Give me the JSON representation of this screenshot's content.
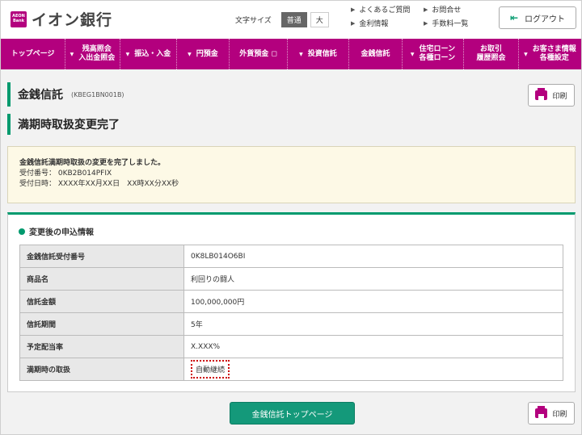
{
  "header": {
    "logo_mark": "AEON Bank",
    "logo_text": "イオン銀行",
    "fontsize_label": "文字サイズ",
    "fontsize_options": [
      "普通",
      "大"
    ],
    "links": [
      "よくあるご質問",
      "お問合せ",
      "金利情報",
      "手数料一覧"
    ],
    "logout_label": "ログアウト"
  },
  "nav": {
    "items": [
      {
        "label": "トップページ",
        "caret": false
      },
      {
        "label": "残高照会\n入出金照会",
        "caret": true
      },
      {
        "label": "振込・入金",
        "caret": true
      },
      {
        "label": "円預金",
        "caret": true
      },
      {
        "label": "外貨預金 ◻",
        "caret": false
      },
      {
        "label": "投資信託",
        "caret": true
      },
      {
        "label": "金銭信託",
        "caret": false
      },
      {
        "label": "住宅ローン\n各種ローン",
        "caret": true
      },
      {
        "label": "お取引\n履歴照会",
        "caret": false
      },
      {
        "label": "お客さま情報\n各種設定",
        "caret": true
      }
    ]
  },
  "page": {
    "title": "金銭信託",
    "code": "(KBEG1BN001B)",
    "subtitle": "満期時取扱変更完了",
    "print_label": "印刷"
  },
  "message": {
    "line1": "金銭信託満期時取扱の変更を完了しました。",
    "line2": "受付番号： 0KB2B014PFIX",
    "line3": "受付日時： XXXX年XX月XX日　XX時XX分XX秒"
  },
  "info": {
    "heading": "変更後の申込情報",
    "rows": [
      {
        "key": "金銭信託受付番号",
        "value": "0K8LB014O6BI"
      },
      {
        "key": "商品名",
        "value": "利回りの闘人"
      },
      {
        "key": "信託金額",
        "value": "100,000,000円"
      },
      {
        "key": "信託期間",
        "value": "5年"
      },
      {
        "key": "予定配当率",
        "value": "X.XXX%"
      },
      {
        "key": "満期時の取扱",
        "value": "自動継続"
      }
    ]
  },
  "footer": {
    "top_button": "金銭信託トップページ",
    "print_label": "印刷"
  }
}
